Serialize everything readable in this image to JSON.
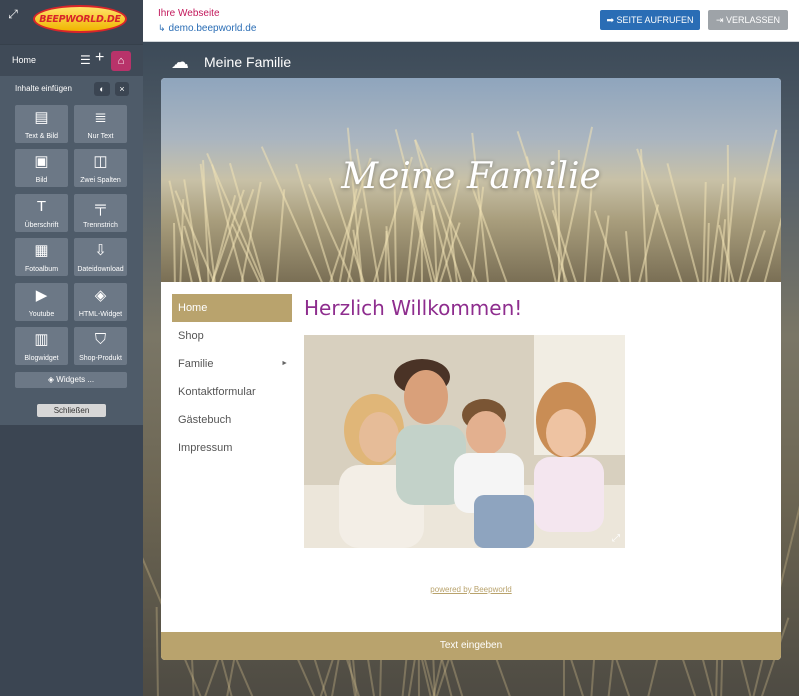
{
  "editor": {
    "logo_text": "BEEPWORLD.DE",
    "page_label": "Home",
    "insert_label": "Inhalte einfügen",
    "tiles": [
      {
        "label": "Text & Bild",
        "icon": "text-image-icon"
      },
      {
        "label": "Nur Text",
        "icon": "text-only-icon"
      },
      {
        "label": "Bild",
        "icon": "image-icon"
      },
      {
        "label": "Zwei Spalten",
        "icon": "two-columns-icon"
      },
      {
        "label": "Überschrift",
        "icon": "heading-icon"
      },
      {
        "label": "Trennstrich",
        "icon": "divider-icon"
      },
      {
        "label": "Fotoalbum",
        "icon": "photo-album-icon"
      },
      {
        "label": "Dateidownload",
        "icon": "download-icon"
      },
      {
        "label": "Youtube",
        "icon": "youtube-icon"
      },
      {
        "label": "HTML-Widget",
        "icon": "html-widget-icon"
      },
      {
        "label": "Blogwidget",
        "icon": "calendar-icon"
      },
      {
        "label": "Shop-Produkt",
        "icon": "shopping-bag-icon"
      }
    ],
    "widgets_label": "Widgets ...",
    "close_label": "Schließen"
  },
  "topbar": {
    "site_label": "Ihre Webseite",
    "site_url": "demo.beepworld.de",
    "visit_label": "SEITE AUFRUFEN",
    "leave_label": "VERLASSEN"
  },
  "site": {
    "title": "Meine Familie",
    "hero_title": "Meine Familie",
    "nav": [
      {
        "label": "Home",
        "active": true
      },
      {
        "label": "Shop"
      },
      {
        "label": "Familie",
        "has_sub": true
      },
      {
        "label": "Kontaktformular"
      },
      {
        "label": "Gästebuch"
      },
      {
        "label": "Impressum"
      }
    ],
    "welcome": "Herzlich Willkommen!",
    "powered_by": "powered by Beepworld",
    "footer_placeholder": "Text eingeben"
  },
  "colors": {
    "accent_gold": "#b9a36d",
    "welcome_purple": "#8e2d8e",
    "home_pink": "#b8336a",
    "primary_blue": "#2a6db5"
  }
}
